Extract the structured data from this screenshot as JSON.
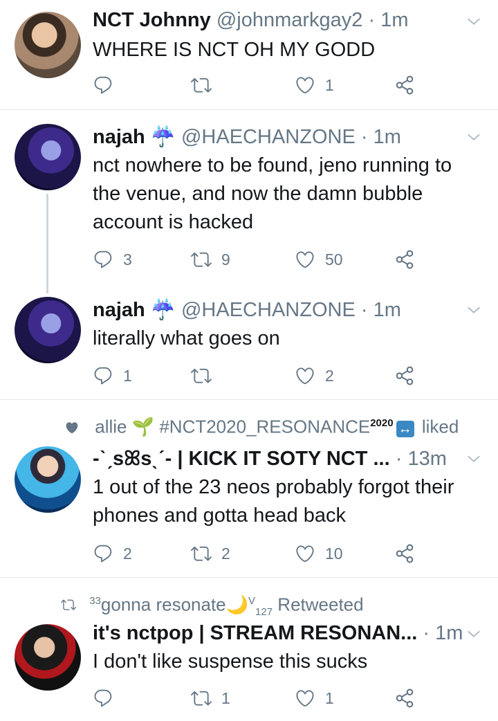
{
  "tweets": [
    {
      "name": "NCT Johnny",
      "handle": "@johnmarkgay2",
      "time": "1m",
      "text": "WHERE IS NCT OH MY GODD",
      "replies": "",
      "retweets": "",
      "likes": "1"
    },
    {
      "name": "najah",
      "name_emoji": "☔",
      "handle": "@HAECHANZONE",
      "time": "1m",
      "text": "nct nowhere to be found, jeno running to the venue, and now the damn bubble account is hacked",
      "replies": "3",
      "retweets": "9",
      "likes": "50"
    },
    {
      "name": "najah",
      "name_emoji": "☔",
      "handle": "@HAECHANZONE",
      "time": "1m",
      "text": "literally what goes on",
      "replies": "1",
      "retweets": "",
      "likes": "2"
    },
    {
      "social_user": "allie",
      "social_emoji": "🌱",
      "social_tag": "#NCT2020_RESONANCE",
      "social_sup": "2020",
      "social_emoji2": "↔",
      "social_action": "liked",
      "name": "-ˋˏsꕤsˎˊ- | KICK IT SOTY NCT ...",
      "handle": "",
      "time": "13m",
      "text": "1 out of the 23 neos probably forgot their phones and gotta head back",
      "replies": "2",
      "retweets": "2",
      "likes": "10"
    },
    {
      "social_sup": "33",
      "social_user": "gonna resonate",
      "social_emoji": "🌙",
      "social_v": "V",
      "social_sub": "127",
      "social_action": "Retweeted",
      "name": "it's nctpop | STREAM RESONAN...",
      "handle": "",
      "time": "1m",
      "text": "I don't like suspense this sucks",
      "replies": "",
      "retweets": "1",
      "likes": "1"
    }
  ],
  "colors": {
    "text": "#14171a",
    "muted": "#657786",
    "divider": "#e1e8ed",
    "thread": "#ccd6dd"
  }
}
